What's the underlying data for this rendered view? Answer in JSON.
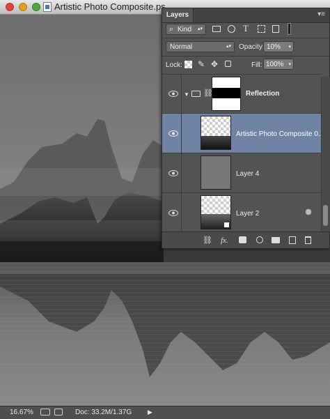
{
  "window": {
    "title": "Artistic Photo Composite.ps",
    "zoom": "16.67%",
    "doc_info": "Doc: 33.2M/1.37G",
    "status_arrow": "▶"
  },
  "layers_panel": {
    "tab_label": "Layers",
    "menu_glyph": "▾≡",
    "filter": {
      "search_glyph": "⌕",
      "kind_label": "Kind",
      "type_icon_glyph": "T"
    },
    "blend_mode": "Normal",
    "opacity_label": "Opacity:",
    "opacity_value": "10%",
    "lock_label": "Lock:",
    "fill_label": "Fill:",
    "fill_value": "100%",
    "layers": [
      {
        "name": "Reflection",
        "type": "group"
      },
      {
        "name": "Artistic Photo Composite 0...",
        "selected": true
      },
      {
        "name": "Layer 4"
      },
      {
        "name": "Layer 2"
      }
    ],
    "footer_fx": "fx."
  },
  "colors": {
    "panel_bg": "#535353",
    "selected_row": "#6f83a4",
    "canvas_dark": "#1f1f1f",
    "status_bg": "#4f4f4f"
  },
  "icons": [
    "close-light",
    "minimize-light",
    "zoom-light",
    "document-icon",
    "search-icon",
    "kind-dropdown",
    "pixel-filter-icon",
    "adjustment-filter-icon",
    "type-filter-icon",
    "shape-filter-icon",
    "smart-object-filter-icon",
    "filter-toggle",
    "lock-transparent-icon",
    "lock-brush-icon",
    "lock-move-icon",
    "lock-all-icon",
    "eye-icon",
    "folder-icon",
    "chain-link-icon",
    "link-layers-icon",
    "fx-icon",
    "mask-icon",
    "adjustment-icon",
    "new-group-icon",
    "new-layer-icon",
    "trash-icon",
    "share-icon"
  ]
}
